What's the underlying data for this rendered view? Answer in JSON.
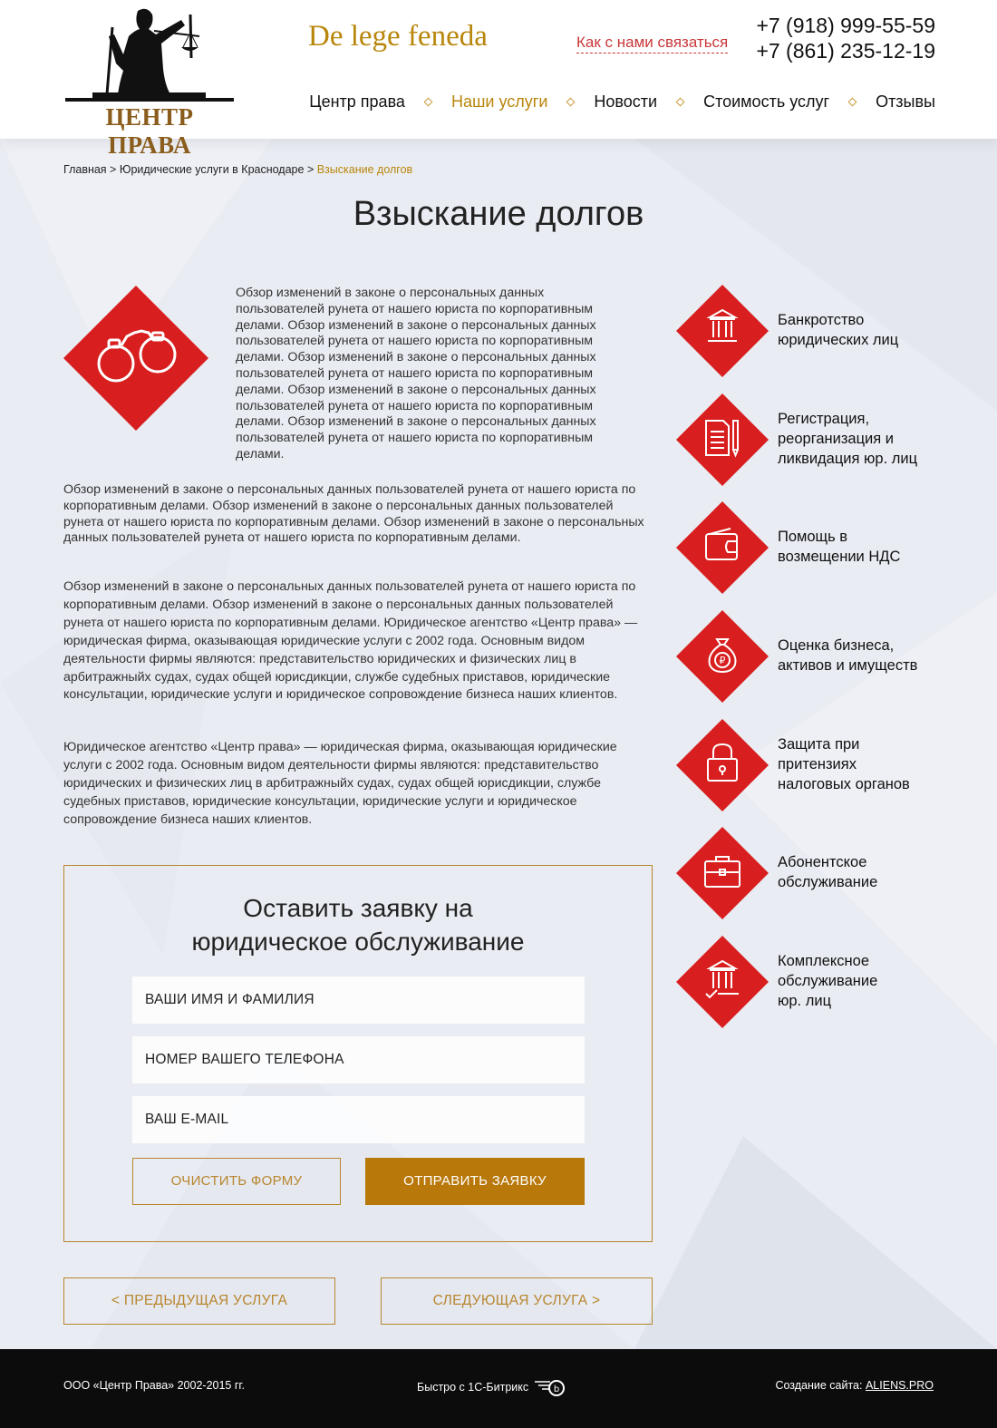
{
  "header": {
    "logo_text": "ЦЕНТР ПРАВА",
    "slogan": "De lege feneda",
    "contact_link": "Как с нами связаться",
    "phones": [
      "+7 (918) 999-55-59",
      "+7 (861) 235-12-19"
    ],
    "nav": [
      {
        "label": "Центр права",
        "active": false
      },
      {
        "label": "Наши услуги",
        "active": true
      },
      {
        "label": "Новости",
        "active": false
      },
      {
        "label": "Стоимость услуг",
        "active": false
      },
      {
        "label": "Отзывы",
        "active": false
      }
    ]
  },
  "breadcrumb": {
    "home": "Главная",
    "sep": " > ",
    "section": "Юридические услуги в Краснодаре",
    "current": "Взыскание долгов"
  },
  "page": {
    "title": "Взыскание долгов",
    "hero_icon": "handcuffs-icon",
    "intro": "Обзор изменений в законе о персональных данных пользователей рунета от нашего юриста по корпоративным делами. Обзор изменений в законе о персональных данных пользователей рунета от нашего юриста по корпоративным делами. Обзор изменений в законе о персональных данных пользователей рунета от нашего юриста по корпоративным делами. Обзор изменений в законе о персональных данных пользователей рунета от нашего юриста по корпоративным делами. Обзор изменений в законе о персональных данных пользователей рунета от нашего юриста по корпоративным делами.",
    "p1": "Обзор изменений в законе о персональных данных пользователей рунета от нашего юриста по корпоративным делами. Обзор изменений в законе о персональных данных пользователей рунета от нашего юриста по корпоративным делами. Обзор изменений в законе о персональных данных пользователей рунета от нашего юриста по корпоративным делами.",
    "p2": "Обзор изменений в законе о персональных данных пользователей рунета от нашего юриста по корпоративным делами. Обзор изменений в законе о персональных данных пользователей рунета от нашего юриста по корпоративным делами.  Юридическое агентство «Центр права» — юридическая фирма, оказывающая юридические услуги с 2002 года. Основным видом деятельности фирмы являются: представительство юридических и физических лиц в арбитражныйх судах, судах общей юрисдикции, службе судебных приставов, юридические консультации, юридические услуги и юридическое сопровождение бизнеса наших клиентов.",
    "p3": "Юридическое агентство «Центр права» — юридическая фирма, оказывающая юридические услуги с 2002 года. Основным видом деятельности фирмы являются: представительство юридических и физических лиц в арбитражныйх судах, судах общей юрисдикции, службе судебных приставов, юридические консультации, юридические услуги и юридическое сопровождение бизнеса наших клиентов."
  },
  "form": {
    "title_line1": "Оставить заявку на",
    "title_line2": "юридическое обслуживание",
    "name_placeholder": "ВАШИ ИМЯ И ФАМИЛИЯ",
    "phone_placeholder": "НОМЕР ВАШЕГО ТЕЛЕФОНА",
    "email_placeholder": "ВАШ E-MAIL",
    "clear_label": "ОЧИСТИТЬ ФОРМУ",
    "send_label": "ОТПРАВИТЬ ЗАЯВКУ"
  },
  "pager": {
    "prev_label": "<  ПРЕДЫДУЩАЯ УСЛУГА",
    "next_label": "СЛЕДУЮЩАЯ УСЛУГА  >"
  },
  "services": [
    {
      "label": "Банкротство\nюридических лиц",
      "icon": "bank-icon"
    },
    {
      "label": "Регистрация,\nреорганизация и\nликвидация юр. лиц",
      "icon": "document-pen-icon"
    },
    {
      "label": "Помощь в\nвозмещении НДС",
      "icon": "wallet-icon"
    },
    {
      "label": "Оценка бизнеса,\nактивов и имуществ",
      "icon": "money-bag-icon"
    },
    {
      "label": "Защита при\nпритензиях\nналоговых органов",
      "icon": "padlock-icon"
    },
    {
      "label": "Абонентское\nобслуживание",
      "icon": "briefcase-icon"
    },
    {
      "label": "Комплексное\nобслуживание\nюр. лиц",
      "icon": "bank-check-icon"
    }
  ],
  "footer": {
    "copyright": "ООО «Центр Права» 2002-2015 гг.",
    "bitrix": "Быстро с 1С-Битрикс",
    "created_label": "Создание сайта:",
    "created_link": "ALIENS.PRO"
  },
  "colors": {
    "accent_gold": "#b8860b",
    "button_gold": "#b8780a",
    "diamond_red": "#d81e1e",
    "link_red": "#c8373a",
    "footer_bg": "#0c0c0c"
  }
}
